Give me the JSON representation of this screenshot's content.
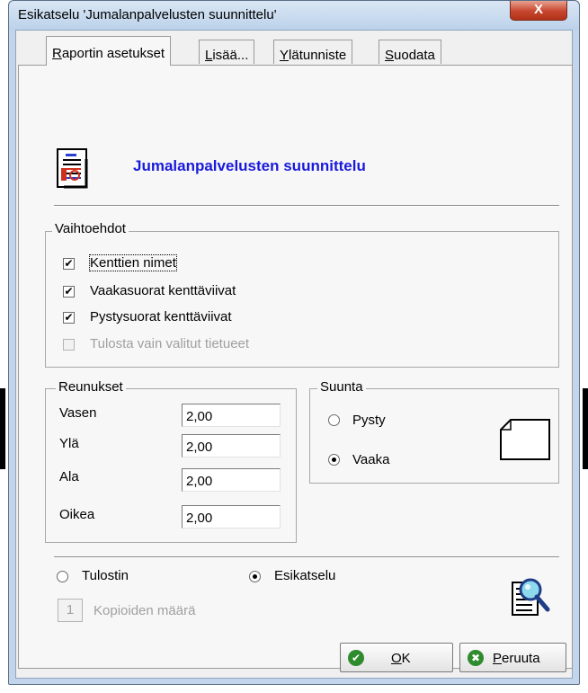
{
  "window": {
    "title": "Esikatselu 'Jumalanpalvelusten suunnittelu'",
    "close_label": "X"
  },
  "tabs": [
    {
      "label": "Raportin asetukset",
      "mnemonic": "R",
      "rest": "aportin asetukset"
    },
    {
      "label": "Lisää...",
      "mnemonic": "L",
      "rest": "isää..."
    },
    {
      "label": "Ylätunniste",
      "mnemonic": "Y",
      "rest": "lätunniste"
    },
    {
      "label": "Suodata",
      "mnemonic": "S",
      "rest": "uodata"
    }
  ],
  "report": {
    "title": "Jumalanpalvelusten suunnittelu",
    "icon": "report-document-icon"
  },
  "options": {
    "legend": "Vaihtoehdot",
    "items": [
      {
        "label": "Kenttien nimet",
        "checked": true,
        "enabled": true
      },
      {
        "label": "Vaakasuorat kenttäviivat",
        "checked": true,
        "enabled": true
      },
      {
        "label": "Pystysuorat kenttäviivat",
        "checked": true,
        "enabled": true
      },
      {
        "label": "Tulosta vain valitut tietueet",
        "checked": false,
        "enabled": false
      }
    ]
  },
  "margins": {
    "legend": "Reunukset",
    "rows": [
      {
        "label": "Vasen",
        "value": "2,00"
      },
      {
        "label": "Ylä",
        "value": "2,00"
      },
      {
        "label": "Ala",
        "value": "2,00"
      },
      {
        "label": "Oikea",
        "value": "2,00"
      }
    ]
  },
  "orientation": {
    "legend": "Suunta",
    "options": [
      {
        "label": "Pysty",
        "selected": false
      },
      {
        "label": "Vaaka",
        "selected": true
      }
    ],
    "icon": "landscape-page-icon"
  },
  "output": {
    "options": [
      {
        "label": "Tulostin",
        "selected": false
      },
      {
        "label": "Esikatselu",
        "selected": true
      }
    ],
    "copies_value": "1",
    "copies_label": "Kopioiden määrä",
    "icon": "print-preview-icon"
  },
  "buttons": {
    "ok": {
      "mnemonic": "O",
      "rest": "K",
      "icon": "check-icon",
      "color": "#2e8b2e"
    },
    "cancel": {
      "mnemonic": "P",
      "rest": "eruuta",
      "icon": "cancel-x-icon",
      "color": "#2e8b2e"
    }
  }
}
